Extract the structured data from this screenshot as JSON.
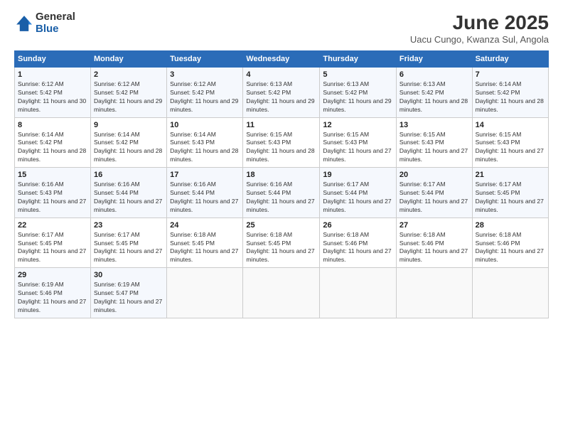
{
  "logo": {
    "general": "General",
    "blue": "Blue"
  },
  "header": {
    "month": "June 2025",
    "location": "Uacu Cungo, Kwanza Sul, Angola"
  },
  "weekdays": [
    "Sunday",
    "Monday",
    "Tuesday",
    "Wednesday",
    "Thursday",
    "Friday",
    "Saturday"
  ],
  "weeks": [
    [
      {
        "day": "1",
        "sunrise": "6:12 AM",
        "sunset": "5:42 PM",
        "daylight": "11 hours and 30 minutes."
      },
      {
        "day": "2",
        "sunrise": "6:12 AM",
        "sunset": "5:42 PM",
        "daylight": "11 hours and 29 minutes."
      },
      {
        "day": "3",
        "sunrise": "6:12 AM",
        "sunset": "5:42 PM",
        "daylight": "11 hours and 29 minutes."
      },
      {
        "day": "4",
        "sunrise": "6:13 AM",
        "sunset": "5:42 PM",
        "daylight": "11 hours and 29 minutes."
      },
      {
        "day": "5",
        "sunrise": "6:13 AM",
        "sunset": "5:42 PM",
        "daylight": "11 hours and 29 minutes."
      },
      {
        "day": "6",
        "sunrise": "6:13 AM",
        "sunset": "5:42 PM",
        "daylight": "11 hours and 28 minutes."
      },
      {
        "day": "7",
        "sunrise": "6:14 AM",
        "sunset": "5:42 PM",
        "daylight": "11 hours and 28 minutes."
      }
    ],
    [
      {
        "day": "8",
        "sunrise": "6:14 AM",
        "sunset": "5:42 PM",
        "daylight": "11 hours and 28 minutes."
      },
      {
        "day": "9",
        "sunrise": "6:14 AM",
        "sunset": "5:42 PM",
        "daylight": "11 hours and 28 minutes."
      },
      {
        "day": "10",
        "sunrise": "6:14 AM",
        "sunset": "5:43 PM",
        "daylight": "11 hours and 28 minutes."
      },
      {
        "day": "11",
        "sunrise": "6:15 AM",
        "sunset": "5:43 PM",
        "daylight": "11 hours and 28 minutes."
      },
      {
        "day": "12",
        "sunrise": "6:15 AM",
        "sunset": "5:43 PM",
        "daylight": "11 hours and 27 minutes."
      },
      {
        "day": "13",
        "sunrise": "6:15 AM",
        "sunset": "5:43 PM",
        "daylight": "11 hours and 27 minutes."
      },
      {
        "day": "14",
        "sunrise": "6:15 AM",
        "sunset": "5:43 PM",
        "daylight": "11 hours and 27 minutes."
      }
    ],
    [
      {
        "day": "15",
        "sunrise": "6:16 AM",
        "sunset": "5:43 PM",
        "daylight": "11 hours and 27 minutes."
      },
      {
        "day": "16",
        "sunrise": "6:16 AM",
        "sunset": "5:44 PM",
        "daylight": "11 hours and 27 minutes."
      },
      {
        "day": "17",
        "sunrise": "6:16 AM",
        "sunset": "5:44 PM",
        "daylight": "11 hours and 27 minutes."
      },
      {
        "day": "18",
        "sunrise": "6:16 AM",
        "sunset": "5:44 PM",
        "daylight": "11 hours and 27 minutes."
      },
      {
        "day": "19",
        "sunrise": "6:17 AM",
        "sunset": "5:44 PM",
        "daylight": "11 hours and 27 minutes."
      },
      {
        "day": "20",
        "sunrise": "6:17 AM",
        "sunset": "5:44 PM",
        "daylight": "11 hours and 27 minutes."
      },
      {
        "day": "21",
        "sunrise": "6:17 AM",
        "sunset": "5:45 PM",
        "daylight": "11 hours and 27 minutes."
      }
    ],
    [
      {
        "day": "22",
        "sunrise": "6:17 AM",
        "sunset": "5:45 PM",
        "daylight": "11 hours and 27 minutes."
      },
      {
        "day": "23",
        "sunrise": "6:17 AM",
        "sunset": "5:45 PM",
        "daylight": "11 hours and 27 minutes."
      },
      {
        "day": "24",
        "sunrise": "6:18 AM",
        "sunset": "5:45 PM",
        "daylight": "11 hours and 27 minutes."
      },
      {
        "day": "25",
        "sunrise": "6:18 AM",
        "sunset": "5:45 PM",
        "daylight": "11 hours and 27 minutes."
      },
      {
        "day": "26",
        "sunrise": "6:18 AM",
        "sunset": "5:46 PM",
        "daylight": "11 hours and 27 minutes."
      },
      {
        "day": "27",
        "sunrise": "6:18 AM",
        "sunset": "5:46 PM",
        "daylight": "11 hours and 27 minutes."
      },
      {
        "day": "28",
        "sunrise": "6:18 AM",
        "sunset": "5:46 PM",
        "daylight": "11 hours and 27 minutes."
      }
    ],
    [
      {
        "day": "29",
        "sunrise": "6:19 AM",
        "sunset": "5:46 PM",
        "daylight": "11 hours and 27 minutes."
      },
      {
        "day": "30",
        "sunrise": "6:19 AM",
        "sunset": "5:47 PM",
        "daylight": "11 hours and 27 minutes."
      },
      null,
      null,
      null,
      null,
      null
    ]
  ],
  "labels": {
    "sunrise": "Sunrise:",
    "sunset": "Sunset:",
    "daylight": "Daylight:"
  }
}
